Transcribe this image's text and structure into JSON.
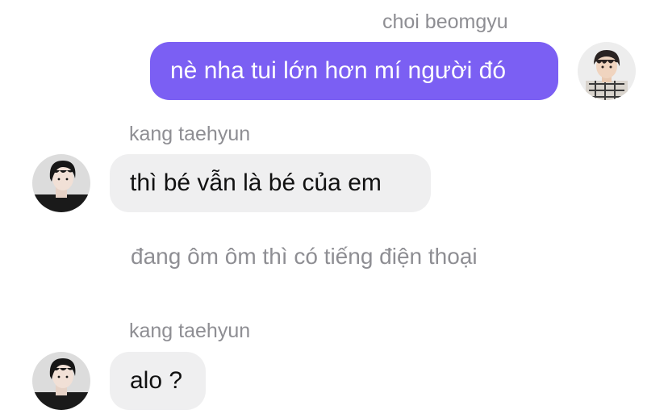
{
  "messages": [
    {
      "sender": "choi beomgyu",
      "text": "nè nha tui lớn hơn mí người đó",
      "direction": "outgoing",
      "avatar_icon": "beomgyu-avatar-icon"
    },
    {
      "sender": "kang taehyun",
      "text": "thì bé vẫn là bé của em",
      "direction": "incoming",
      "avatar_icon": "taehyun-avatar-icon"
    },
    {
      "type": "narration",
      "text": "đang ôm ôm thì có tiếng điện thoại"
    },
    {
      "sender": "kang taehyun",
      "text": "alo ?",
      "direction": "incoming",
      "avatar_icon": "taehyun-avatar-icon"
    }
  ],
  "colors": {
    "outgoing_bubble": "#7b5ff3",
    "incoming_bubble": "#efeff0",
    "sender_name": "#8e8e93",
    "narration": "#8e8e93"
  }
}
